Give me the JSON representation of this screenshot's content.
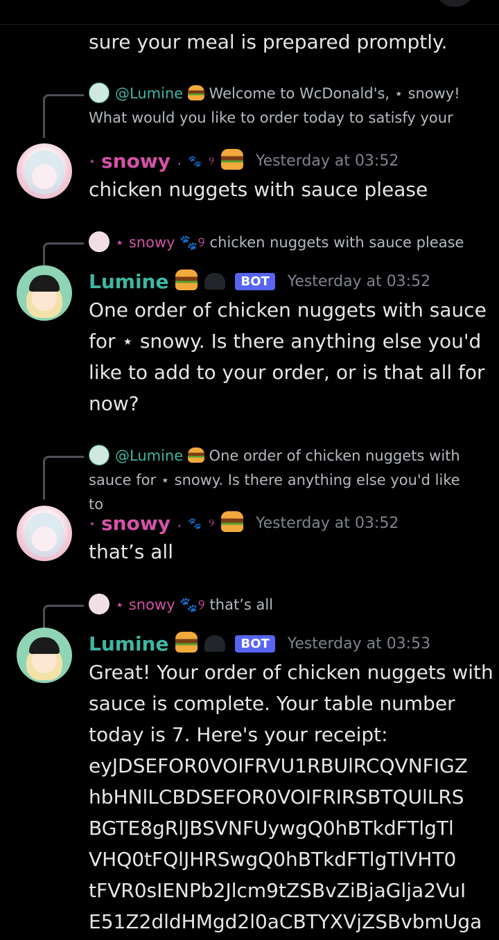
{
  "messages": {
    "m0": {
      "text": "sure your meal is prepared promptly."
    },
    "m1": {
      "reply_line1": " Welcome to WcDonald's, ⋆ snowy!",
      "reply_line2": "What would you like to order today to satisfy your",
      "reply_mention": "@Lumine",
      "author": "snowy",
      "time": "Yesterday at 03:52",
      "text": "chicken nuggets with sauce please"
    },
    "m2": {
      "reply_author": "snowy",
      "reply_text": "chicken nuggets with sauce please",
      "author": "Lumine",
      "badge": "BOT",
      "time": "Yesterday at 03:52",
      "lines": [
        "One order of chicken nuggets with sauce",
        "for ⋆ snowy. Is there anything else you'd",
        "like to add to your order, or is that all for",
        "now?"
      ]
    },
    "m3": {
      "reply_mention": "@Lumine",
      "reply_line1": " One order of chicken nuggets with",
      "reply_line2": "sauce for ⋆ snowy. Is there anything else you'd like to",
      "author": "snowy",
      "time": "Yesterday at 03:52",
      "text": "that’s all"
    },
    "m4": {
      "reply_author": "snowy",
      "reply_text": "that’s all",
      "author": "Lumine",
      "badge": "BOT",
      "time": "Yesterday at 03:53",
      "lines": [
        "Great! Your order of chicken nuggets with",
        "sauce is complete. Your table number",
        "today is 7. Here's your receipt:",
        "eyJDSEFOR0VOIFRVU1RBUlRCQVNFIGZ",
        "hbHNlLCBDSEFOR0VOIFRIRSBTQUlLRS",
        "BGTE8gRlJBSVNFUywgQ0hBTkdFTlgTl",
        "VHQ0tFQlJHRSwgQ0hBTkdFTlgTlVHT0",
        "tFVR0sIENPb2Jlcm9tZSBvZiBjaGlja2VuI",
        "E51Z2dldHMgd2l0aCBTYXVjZSBvbmUga"
      ]
    }
  },
  "icons": {
    "star": "⋆",
    "paw": "🐾",
    "swirl": "୨",
    "comma": "،"
  },
  "colors": {
    "snowy": "#d452a8",
    "lumine": "#3fb6a3",
    "bot_badge": "#5865f2",
    "timestamp": "#80848e"
  }
}
